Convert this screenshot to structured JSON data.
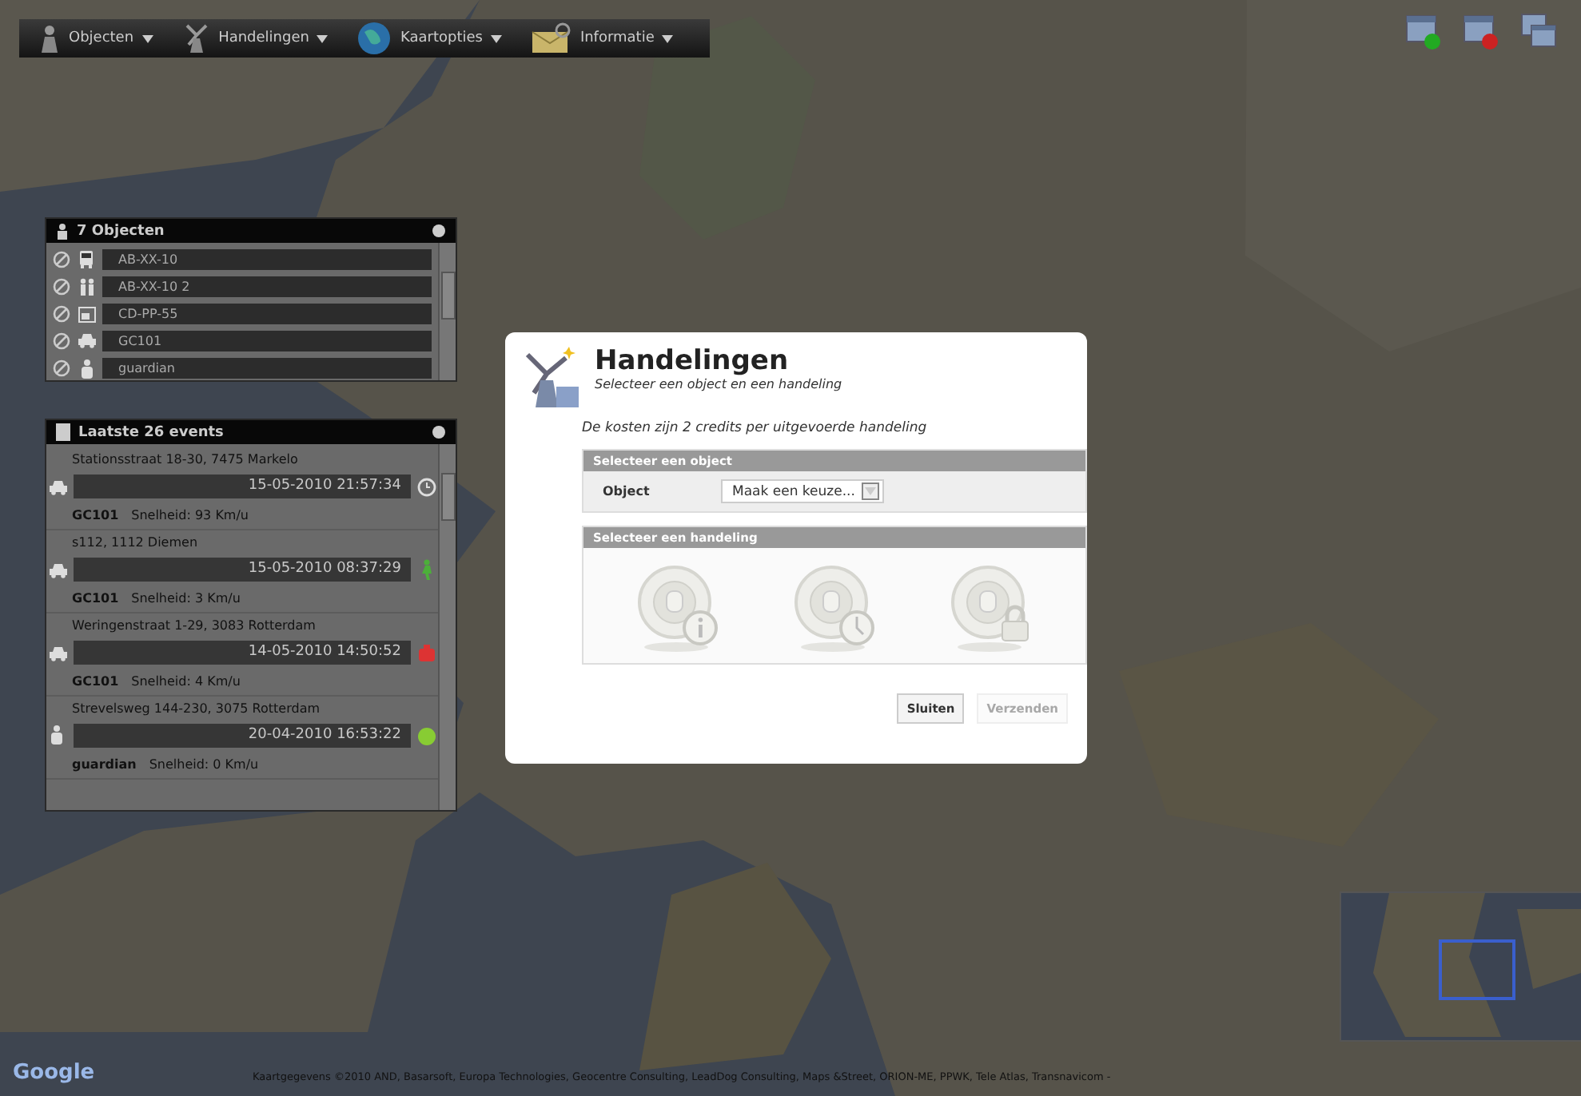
{
  "toolbar": {
    "menus": [
      {
        "label": "Objecten"
      },
      {
        "label": "Handelingen"
      },
      {
        "label": "Kaartopties"
      },
      {
        "label": "Informatie"
      }
    ]
  },
  "map": {
    "logo": "Google",
    "attribution": "Kaartgegevens ©2010 AND, Basarsoft, Europa Technologies, Geocentre Consulting, LeadDog Consulting, Maps &Street, ORION-ME, PPWK, Tele Atlas, Transnavicom -"
  },
  "objects_panel": {
    "title": "7 Objecten",
    "items": [
      {
        "name": "AB-XX-10",
        "kind": "bus"
      },
      {
        "name": "AB-XX-10 2",
        "kind": "people"
      },
      {
        "name": "CD-PP-55",
        "kind": "screen"
      },
      {
        "name": "GC101",
        "kind": "car"
      },
      {
        "name": "guardian",
        "kind": "person"
      }
    ]
  },
  "events_panel": {
    "title": "Laatste 26 events",
    "items": [
      {
        "address": "Stationsstraat 18-30, 7475 Markelo",
        "date": "15-05-2010 21:57:34",
        "status": {
          "kind": "clock"
        },
        "vehicle": {
          "kind": "car"
        },
        "object": "GC101",
        "speed": "Snelheid: 93 Km/u"
      },
      {
        "address": "s112, 1112 Diemen",
        "date": "15-05-2010 08:37:29",
        "status": {
          "kind": "walk"
        },
        "vehicle": {
          "kind": "car"
        },
        "object": "GC101",
        "speed": "Snelheid: 3 Km/u"
      },
      {
        "address": "Weringenstraat 1-29, 3083 Rotterdam",
        "date": "14-05-2010 14:50:52",
        "status": {
          "kind": "alarm"
        },
        "vehicle": {
          "kind": "car"
        },
        "object": "GC101",
        "speed": "Snelheid: 4 Km/u"
      },
      {
        "address": "Strevelsweg 144-230, 3075 Rotterdam",
        "date": "20-04-2010 16:53:22",
        "status": {
          "kind": "ok"
        },
        "vehicle": {
          "kind": "person"
        },
        "object": "guardian",
        "speed": "Snelheid: 0 Km/u"
      }
    ]
  },
  "dialog": {
    "title": "Handelingen",
    "subtitle": "Selecteer een object en een handeling",
    "note": "De kosten zijn 2 credits per uitgevoerde handeling",
    "object_section": {
      "title": "Selecteer een object",
      "label": "Object",
      "value": "Maak een keuze..."
    },
    "action_section": {
      "title": "Selecteer een handeling",
      "actions": [
        {
          "kind": "info"
        },
        {
          "kind": "clock"
        },
        {
          "kind": "lock"
        }
      ]
    },
    "buttons": [
      {
        "label": "Sluiten",
        "disabled": false
      },
      {
        "label": "Verzenden",
        "disabled": true
      }
    ]
  }
}
